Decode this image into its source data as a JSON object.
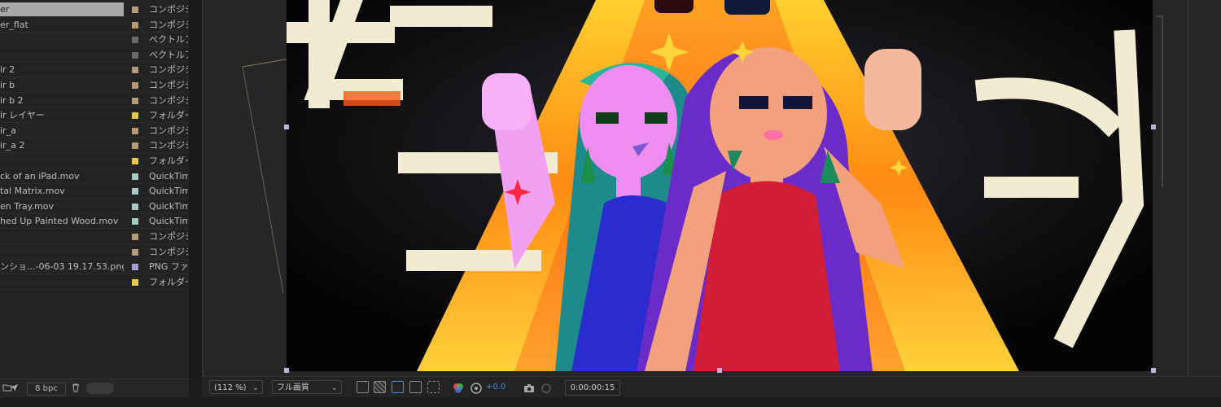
{
  "project": {
    "items": [
      {
        "name": "er",
        "type": "コンポジシ",
        "color": "#b59a78",
        "selected": true
      },
      {
        "name": "er_flat",
        "type": "コンポジシ",
        "color": "#b59a78"
      },
      {
        "name": "",
        "type": "ベクトルア",
        "color": "#6a6a6a"
      },
      {
        "name": "",
        "type": "ベクトルア",
        "color": "#6a6a6a"
      },
      {
        "name": "ir 2",
        "type": "コンポジシ",
        "color": "#b59a78"
      },
      {
        "name": "ir b",
        "type": "コンポジシ",
        "color": "#b59a78"
      },
      {
        "name": "ir b 2",
        "type": "コンポジシ",
        "color": "#b59a78"
      },
      {
        "name": "ir レイヤー",
        "type": "フォルダー",
        "color": "#e3c84a"
      },
      {
        "name": "ir_a",
        "type": "コンポジシ",
        "color": "#b59a78"
      },
      {
        "name": "ir_a 2",
        "type": "コンポジシ",
        "color": "#b59a78"
      },
      {
        "name": "",
        "type": "フォルダー",
        "color": "#e3c84a"
      },
      {
        "name": "ck of an iPad.mov",
        "type": "QuickTim",
        "color": "#a9c9c9"
      },
      {
        "name": "tal Matrix.mov",
        "type": "QuickTim",
        "color": "#a9c9c9"
      },
      {
        "name": "en Tray.mov",
        "type": "QuickTim",
        "color": "#a9c9c9"
      },
      {
        "name": "hed Up Painted Wood.mov",
        "type": "QuickTim",
        "color": "#a9c9c9"
      },
      {
        "name": "",
        "type": "コンポジシ",
        "color": "#b59a78"
      },
      {
        "name": "",
        "type": "コンポジシ",
        "color": "#b59a78"
      },
      {
        "name": "ンショ...-06-03 19.17.53.png",
        "type": "PNG ファ",
        "color": "#a8a0d0"
      },
      {
        "name": "",
        "type": "フォルダー",
        "color": "#e3c84a"
      }
    ],
    "footer": {
      "bpc": "8 bpc",
      "icons": [
        "folder-icon",
        "send-icon",
        "trash-icon"
      ]
    }
  },
  "viewer": {
    "zoom": "(112 %)",
    "resolution": "フル画質",
    "exposure": "+0.0",
    "timecode": "0:00:00:15",
    "artwork_text": [
      "セ",
      "ニ",
      "ノ",
      "ヘ",
      "ン"
    ]
  }
}
